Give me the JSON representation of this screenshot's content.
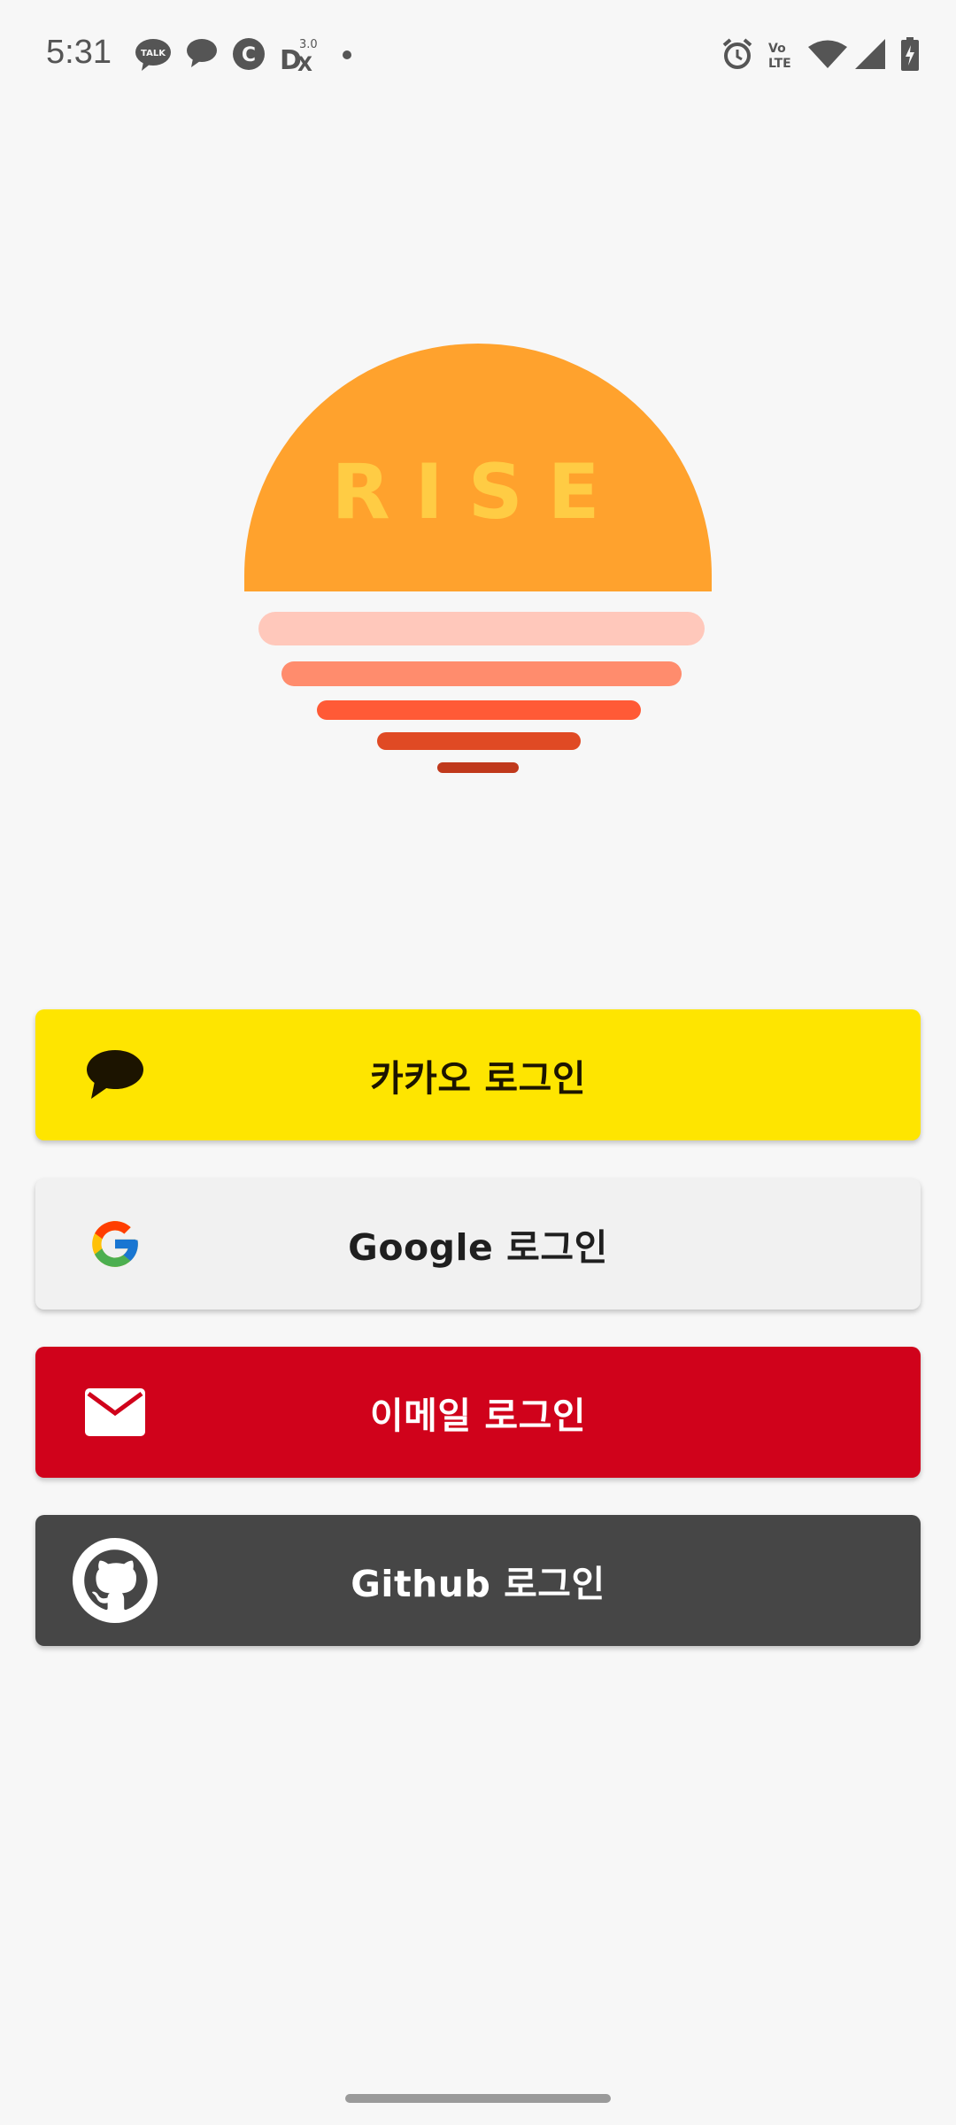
{
  "status_bar": {
    "time": "5:31",
    "left_icons": [
      "kakaotalk-icon",
      "chat-bubble-icon",
      "c-app-icon",
      "dx-app-icon",
      "dot-icon"
    ],
    "right_icons": [
      "alarm-icon",
      "volte-icon",
      "wifi-icon",
      "signal-icon",
      "battery-icon"
    ],
    "dx_version": "3.0"
  },
  "logo": {
    "text": "RISE",
    "sun_color": "#ffa22d",
    "text_color": "#ffcc44",
    "stripe_colors": [
      "#ffc8bb",
      "#ff8c6d",
      "#ff5a36",
      "#e04a24",
      "#c0391c"
    ]
  },
  "buttons": {
    "kakao": {
      "label": "카카오 로그인",
      "icon": "kakao-speech-bubble-icon",
      "color": "#fee500"
    },
    "google": {
      "label": "Google 로그인",
      "icon": "google-g-icon",
      "color": "#f1f1f1"
    },
    "email": {
      "label": "이메일 로그인",
      "icon": "mail-envelope-icon",
      "color": "#d0021b"
    },
    "github": {
      "label": "Github 로그인",
      "icon": "github-octocat-icon",
      "color": "#464646"
    }
  }
}
